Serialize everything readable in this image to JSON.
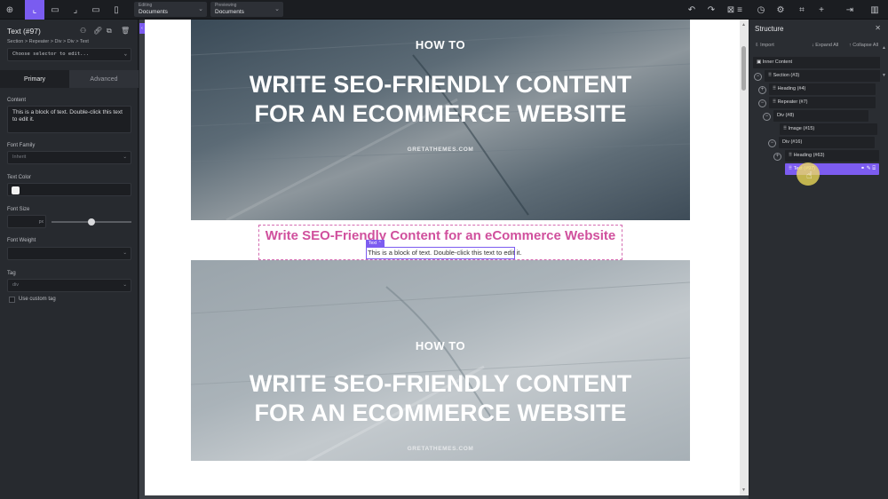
{
  "colors": {
    "accent": "#7c5cf0",
    "pink": "#d0509d",
    "panel": "#272a2f"
  },
  "toolbar": {
    "left_icons": [
      "wordpress-icon",
      "preview-layout-icon",
      "layout-icon",
      "corner-icon",
      "tablet-landscape-icon",
      "phone-icon"
    ],
    "editing": {
      "label": "Editing",
      "value": "Documents"
    },
    "previewing": {
      "label": "Previewing",
      "value": "Documents"
    },
    "right_icons": [
      "undo-icon",
      "redo-icon",
      "close-square-icon",
      "list-icon",
      "history-icon",
      "gear-icon",
      "code-icon",
      "plus-icon",
      "exit-icon",
      "sidebar-icon"
    ]
  },
  "panel": {
    "title": "Text (#97)",
    "breadcrumb": "Section > Repeater > Div > Div > Text",
    "selector_placeholder": "Choose selector to edit...",
    "tabs": [
      "Primary",
      "Advanced"
    ],
    "content_label": "Content",
    "content_value": "This is a block of text. Double-click this text to edit it.",
    "font_family_label": "Font Family",
    "font_family_value": "Inherit",
    "text_color_label": "Text Color",
    "font_size_label": "Font Size",
    "font_size_unit": "px",
    "font_size_slider": 0.5,
    "font_weight_label": "Font Weight",
    "tag_label": "Tag",
    "tag_value": "div",
    "custom_tag_label": "Use custom tag"
  },
  "page": {
    "hero1": {
      "kicker": "HOW TO",
      "title_line1": "WRITE SEO-FRIENDLY CONTENT",
      "title_line2": "FOR AN ECOMMERCE WEBSITE",
      "site": "GRETATHEMES.COM"
    },
    "heading": "Write SEO-Friendly Content for an eCommerce Website",
    "text_badge": "Text",
    "text_block": "This is a block of text. Double-click this text to edit it.",
    "hero2": {
      "kicker": "HOW TO",
      "title_line1": "WRITE SEO-FRIENDLY CONTENT",
      "title_line2": "FOR AN ECOMMERCE WEBSITE",
      "site": "GRETATHEMES.COM"
    }
  },
  "structure": {
    "title": "Structure",
    "import": "Import",
    "expand_all": "Expand All",
    "collapse_all": "Collapse All",
    "nodes": [
      {
        "label": "Inner Content"
      },
      {
        "label": "Section (#3)"
      },
      {
        "label": "Heading (#4)"
      },
      {
        "label": "Repeater (#7)"
      },
      {
        "label": "Div (#8)"
      },
      {
        "label": "Image (#15)"
      },
      {
        "label": "Div (#16)"
      },
      {
        "label": "Heading (#63)"
      },
      {
        "label": "Text (#97)"
      }
    ]
  }
}
